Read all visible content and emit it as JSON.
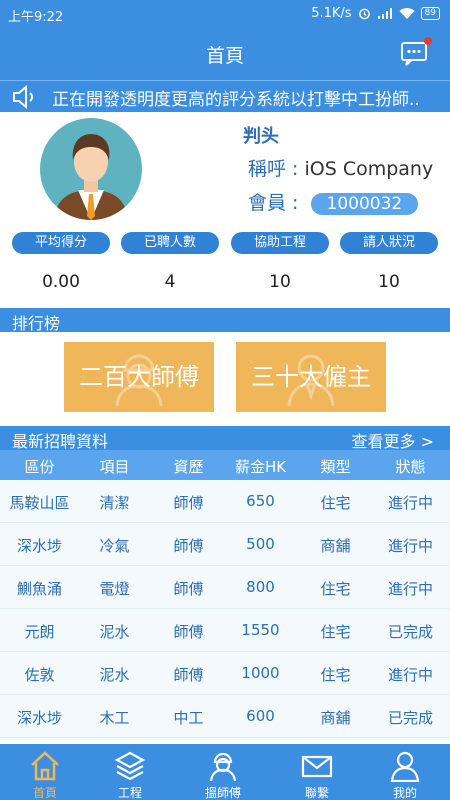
{
  "status_bar": {
    "time": "上午9:22",
    "net_speed": "5.1K/s",
    "battery": "89"
  },
  "app_bar": {
    "title": "首頁",
    "message_icon": "chat-bubble-icon"
  },
  "marquee": {
    "text": "正在開發透明度更高的評分系統以打擊中工扮師.."
  },
  "profile": {
    "name": "判头",
    "title_label": "稱呼 :",
    "title_value": "iOS Company",
    "member_label": "會員 :",
    "member_value": "1000032"
  },
  "stats": [
    {
      "label": "平均得分",
      "value": "0.00"
    },
    {
      "label": "已聘人數",
      "value": "4"
    },
    {
      "label": "協助工程",
      "value": "10"
    },
    {
      "label": "請人狀況",
      "value": "10"
    }
  ],
  "ranking": {
    "title": "排行榜",
    "items": [
      "二百大師傅",
      "三十大僱主"
    ]
  },
  "jobs": {
    "title": "最新招聘資料",
    "more": "查看更多 >",
    "headers": [
      "區份",
      "項目",
      "資歷",
      "薪金HK",
      "類型",
      "狀態"
    ],
    "rows": [
      [
        "馬鞍山區",
        "清潔",
        "師傅",
        "650",
        "住宅",
        "進行中"
      ],
      [
        "深水埗",
        "冷氣",
        "師傅",
        "500",
        "商舖",
        "進行中"
      ],
      [
        "鰂魚涌",
        "電燈",
        "師傅",
        "800",
        "住宅",
        "進行中"
      ],
      [
        "元朗",
        "泥水",
        "師傅",
        "1550",
        "住宅",
        "已完成"
      ],
      [
        "佐敦",
        "泥水",
        "師傅",
        "1000",
        "住宅",
        "進行中"
      ],
      [
        "深水埗",
        "木工",
        "中工",
        "600",
        "商舖",
        "已完成"
      ]
    ]
  },
  "tabs": [
    {
      "label": "首頁",
      "icon": "home-icon",
      "active": true
    },
    {
      "label": "工程",
      "icon": "layers-icon",
      "active": false
    },
    {
      "label": "搵師傅",
      "icon": "worker-icon",
      "active": false
    },
    {
      "label": "聯繫",
      "icon": "mail-icon",
      "active": false
    },
    {
      "label": "我的",
      "icon": "user-icon",
      "active": false
    }
  ],
  "colors": {
    "primary": "#3c8ee0",
    "accent": "#f0b65a",
    "row_bg": "#f4f9fd",
    "text_blue": "#2b6fb6"
  }
}
